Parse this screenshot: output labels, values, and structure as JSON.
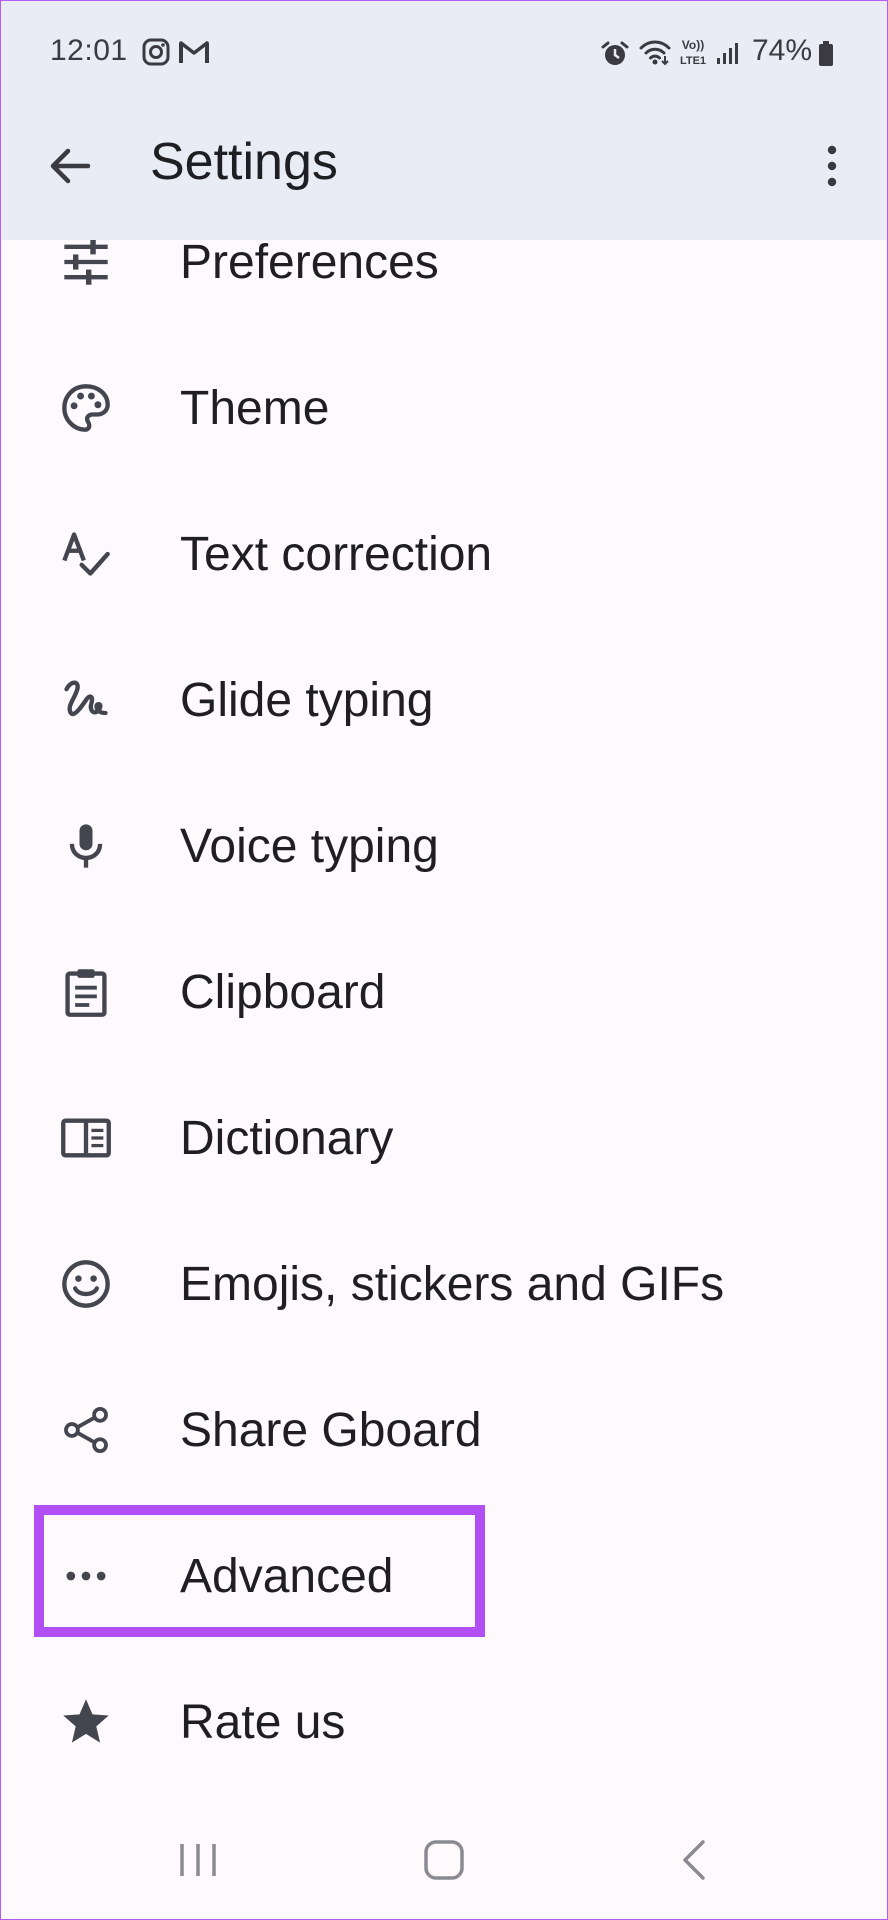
{
  "status_bar": {
    "time": "12:01",
    "battery": "74%",
    "notification_icons": [
      "instagram-icon",
      "gmail-icon"
    ],
    "system_icons": [
      "alarm-icon",
      "wifi-icon",
      "volte-icon",
      "signal-icon",
      "battery-icon"
    ]
  },
  "app_bar": {
    "title": "Settings",
    "back_icon": "arrow-back-icon",
    "menu_icon": "more-vert-icon"
  },
  "settings_items": [
    {
      "label": "Preferences",
      "icon": "tune-icon"
    },
    {
      "label": "Theme",
      "icon": "palette-icon"
    },
    {
      "label": "Text correction",
      "icon": "spellcheck-icon"
    },
    {
      "label": "Glide typing",
      "icon": "gesture-icon"
    },
    {
      "label": "Voice typing",
      "icon": "mic-icon"
    },
    {
      "label": "Clipboard",
      "icon": "clipboard-icon"
    },
    {
      "label": "Dictionary",
      "icon": "dictionary-icon"
    },
    {
      "label": "Emojis, stickers and GIFs",
      "icon": "emoji-icon"
    },
    {
      "label": "Share Gboard",
      "icon": "share-icon"
    },
    {
      "label": "Advanced",
      "icon": "more-horiz-icon"
    },
    {
      "label": "Rate us",
      "icon": "star-icon"
    }
  ],
  "highlighted_item": "Advanced",
  "nav_bar": [
    "recents-icon",
    "home-icon",
    "back-icon"
  ],
  "colors": {
    "app_bar_bg": "#e9ebf5",
    "page_bg": "#fdf9fd",
    "highlight": "#b14ff5",
    "icon": "#44464f"
  }
}
